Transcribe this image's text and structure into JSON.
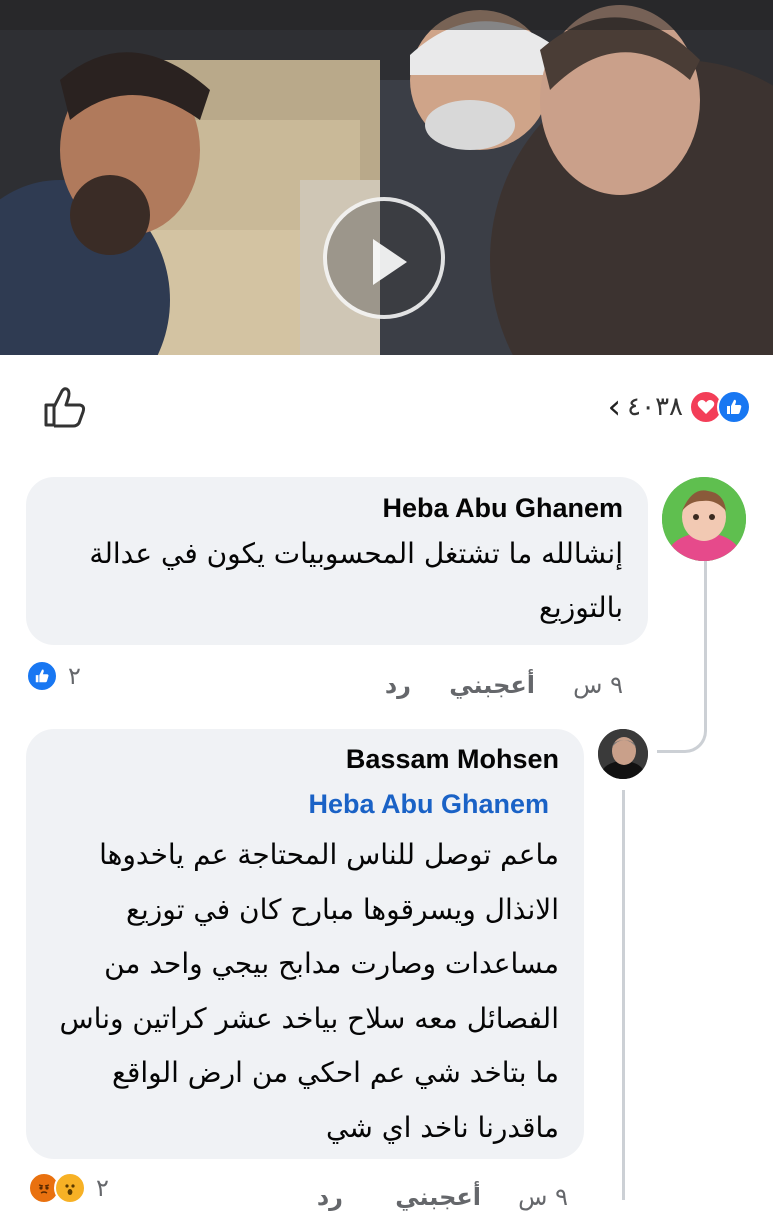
{
  "video": {
    "play_icon": "play-icon"
  },
  "post_actions": {
    "like_icon": "thumbs-up-outline-icon",
    "reaction_count": "٤٠٣٨",
    "chevron": "‹",
    "reaction_icons": [
      "love-icon",
      "like-icon"
    ]
  },
  "comments": [
    {
      "author": "Heba Abu Ghanem",
      "text": "إنشالله ما تشتغل المحسوبيات يكون في عدالة بالتوزيع",
      "time": "٩ س",
      "like_label": "أعجبني",
      "reply_label": "رد",
      "reaction_count": "٢",
      "reaction_icons": [
        "like-icon"
      ]
    },
    {
      "author": "Bassam Mohsen",
      "mention": "Heba Abu Ghanem",
      "text": "ماعم توصل للناس المحتاجة عم ياخدوها الانذال ويسرقوها مبارح كان في توزيع مساعدات وصارت مدابح بيجي واحد من الفصائل معه سلاح بياخد عشر كراتين وناس ما بتاخد شي عم احكي من ارض الواقع ماقدرنا ناخد اي شي",
      "time": "٩ س",
      "like_label": "أعجبني",
      "reply_label": "رد",
      "reaction_count": "٢",
      "reaction_icons": [
        "angry-icon",
        "wow-icon"
      ]
    }
  ],
  "colors": {
    "bubble": "#f0f2f5",
    "link": "#1a62c6",
    "meta": "#65676b",
    "like_blue": "#1877f2",
    "love_red": "#f33e58"
  }
}
